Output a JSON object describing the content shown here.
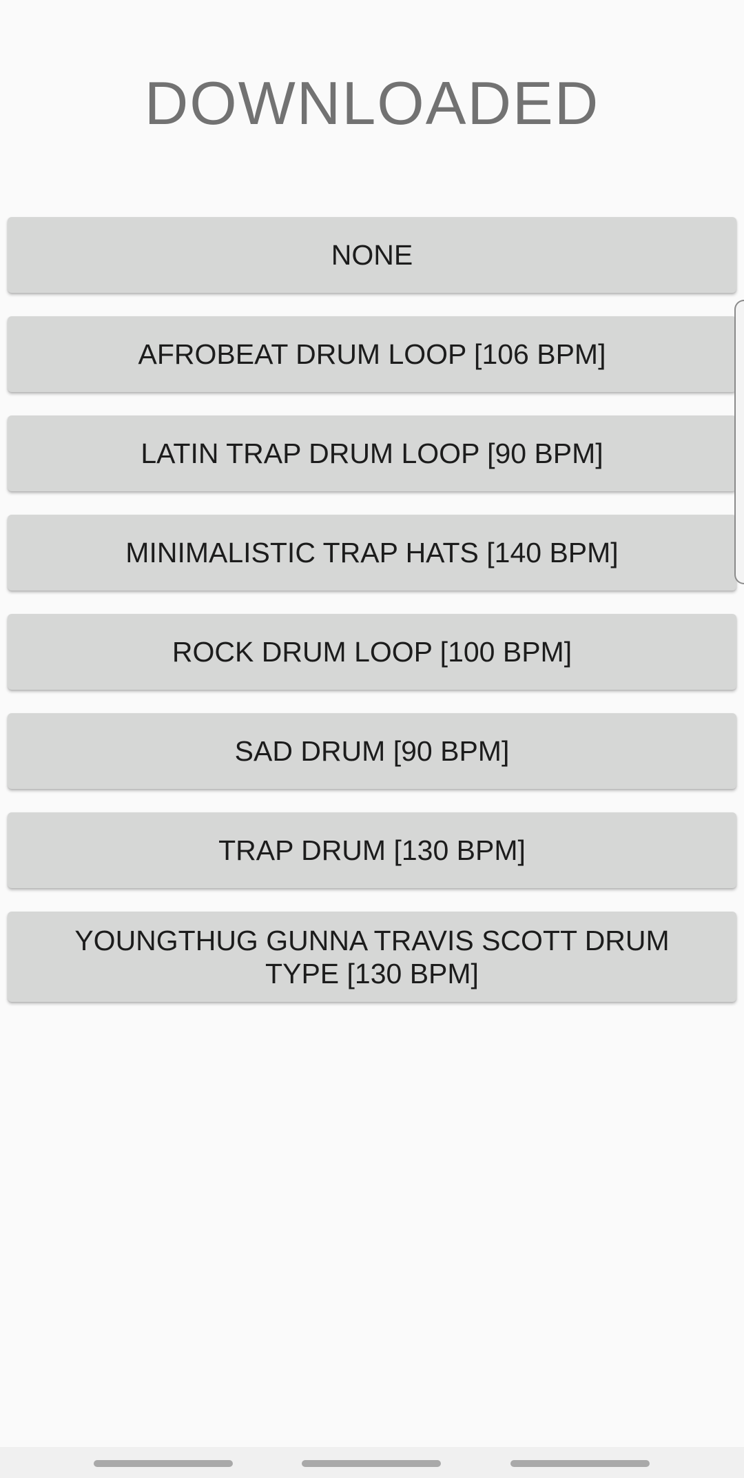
{
  "header": {
    "title": "DOWNLOADED"
  },
  "loops": [
    {
      "label": "NONE"
    },
    {
      "label": "AFROBEAT DRUM LOOP [106 BPM]"
    },
    {
      "label": "LATIN TRAP DRUM LOOP [90 BPM]"
    },
    {
      "label": "MINIMALISTIC TRAP HATS [140 BPM]"
    },
    {
      "label": "ROCK DRUM LOOP [100 BPM]"
    },
    {
      "label": "SAD DRUM [90 BPM]"
    },
    {
      "label": "TRAP DRUM [130 BPM]"
    },
    {
      "label": "YOUNGTHUG GUNNA TRAVIS SCOTT DRUM TYPE [130 BPM]"
    }
  ],
  "colors": {
    "background": "#fafafa",
    "button": "#d6d7d6",
    "title_text": "#727272",
    "button_text": "#1c1c1c"
  }
}
